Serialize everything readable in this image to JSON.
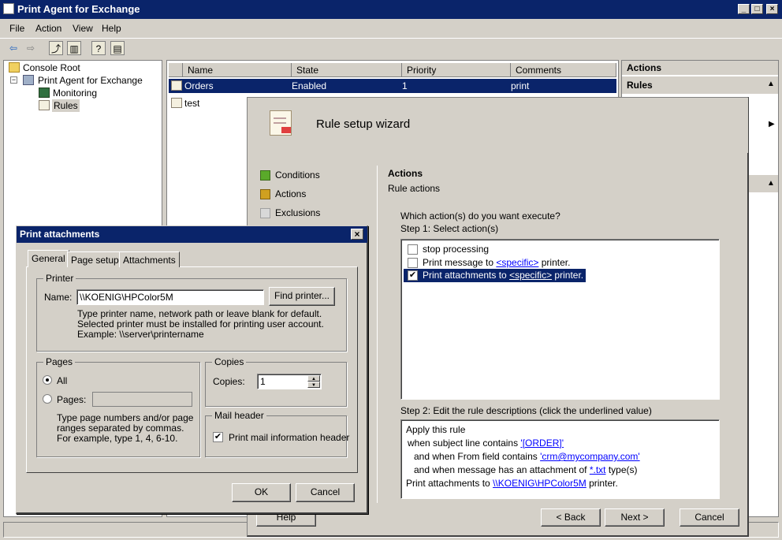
{
  "window": {
    "title": "Print Agent for Exchange",
    "min": "_",
    "max": "□",
    "close": "×"
  },
  "menu": [
    "File",
    "Action",
    "View",
    "Help"
  ],
  "tree": {
    "root": "Console Root",
    "app": "Print Agent for Exchange",
    "monitoring": "Monitoring",
    "rules": "Rules"
  },
  "list": {
    "columns": [
      "Name",
      "State",
      "Priority",
      "Comments"
    ],
    "rows": [
      {
        "name": "Orders",
        "state": "Enabled",
        "priority": "1",
        "comments": "print"
      },
      {
        "name": "test",
        "state": "",
        "priority": "",
        "comments": ""
      }
    ]
  },
  "actions": {
    "header": "Actions",
    "section": "Rules"
  },
  "wizard": {
    "title": "Rule setup wizard",
    "steps": [
      "Conditions",
      "Actions",
      "Exclusions"
    ],
    "section_title": "Actions",
    "section_sub": "Rule actions",
    "question": "Which action(s) do you want execute?",
    "step1": "Step 1: Select action(s)",
    "options": [
      {
        "label": "stop processing",
        "checked": false
      },
      {
        "label_a": "Print message to ",
        "link": "<specific>",
        "label_b": " printer.",
        "checked": false
      },
      {
        "label_a": "Print attachments to ",
        "link": "<specific>",
        "label_b": " printer.",
        "checked": true
      }
    ],
    "step2": "Step 2: Edit the rule descriptions (click the underlined value)",
    "desc": {
      "l1": "Apply this rule",
      "l2a": "when subject line contains ",
      "l2link": "'[ORDER]'",
      "l3a": "and when From field contains ",
      "l3link": "'crm@mycompany.com'",
      "l4a": "and when message has an attachment of ",
      "l4link": "*.txt",
      "l4b": " type(s)",
      "l5a": "Print attachments to ",
      "l5link": "\\\\KOENIG\\HPColor5M",
      "l5b": " printer."
    },
    "buttons": {
      "help": "Help",
      "back": "< Back",
      "next": "Next >",
      "cancel": "Cancel"
    }
  },
  "dialog": {
    "title": "Print attachments",
    "tabs": [
      "General",
      "Page setup",
      "Attachments"
    ],
    "printer_group": "Printer",
    "name_label": "Name:",
    "name_value": "\\\\KOENIG\\HPColor5M",
    "find_button": "Find printer...",
    "hint1": "Type printer name, network path or leave blank for default.",
    "hint2": "Selected printer must be installed for printing user account.",
    "hint3": "Example: \\\\server\\printername",
    "pages_group": "Pages",
    "all_label": "All",
    "pages_label": "Pages:",
    "pages_hint1": "Type page numbers and/or page",
    "pages_hint2": "ranges separated by commas.",
    "pages_hint3": "For example, type 1, 4, 6-10.",
    "copies_group": "Copies",
    "copies_label": "Copies:",
    "copies_value": "1",
    "mail_group": "Mail header",
    "mail_label": "Print mail information header",
    "ok": "OK",
    "cancel": "Cancel"
  }
}
